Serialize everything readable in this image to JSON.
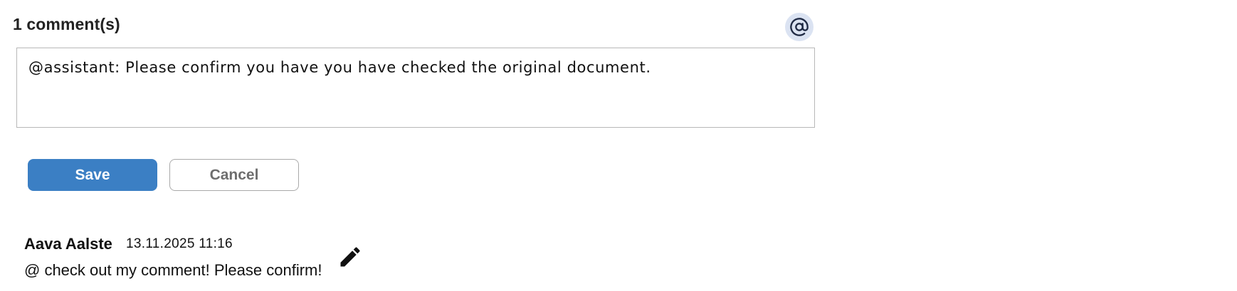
{
  "comments": {
    "count_label": "1 comment(s)",
    "mention_icon": "at-sign-icon",
    "input": {
      "value": "@assistant: Please confirm you have you have checked the original document.",
      "placeholder": ""
    },
    "actions": {
      "save_label": "Save",
      "cancel_label": "Cancel"
    },
    "colors": {
      "primary": "#3b7fc4",
      "mention_bg": "#dbe3f2"
    },
    "items": [
      {
        "author": "Aava Aalste",
        "timestamp": "13.11.2025 11:16",
        "text": "@ check out my comment! Please confirm!",
        "edit_icon": "pencil-icon"
      }
    ]
  }
}
